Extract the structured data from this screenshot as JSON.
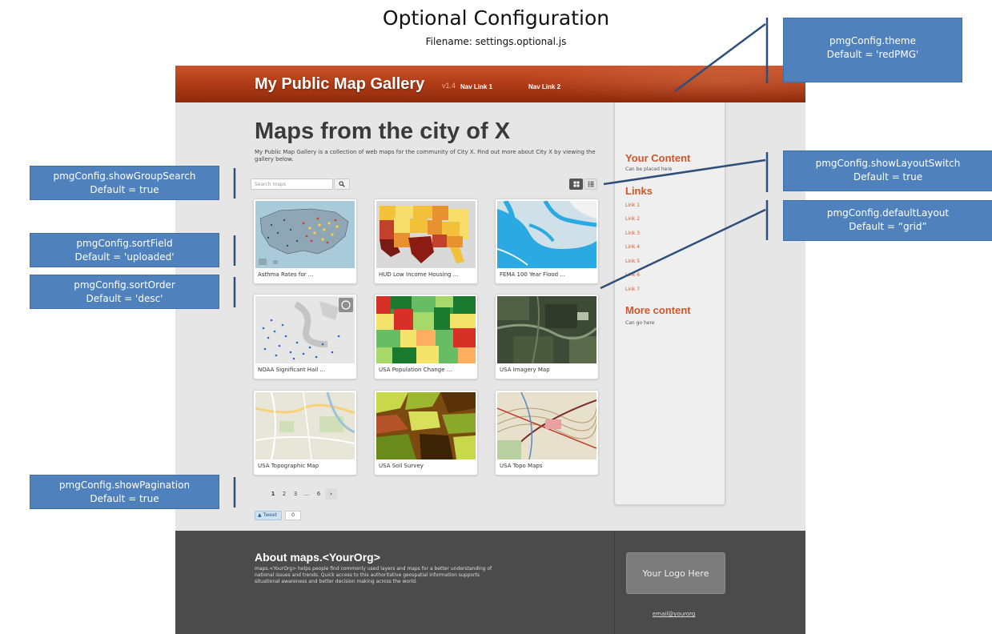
{
  "slide": {
    "title": "Optional Configuration",
    "subtitle": "Filename: settings.optional.js"
  },
  "header": {
    "brand": "My Public Map Gallery",
    "version": "v1.4",
    "nav": [
      "Nav Link 1",
      "Nav Link 2"
    ],
    "theme_color": "#b33d18"
  },
  "main": {
    "title": "Maps from the city of X",
    "intro": "My Public Map Gallery is a collection of web maps for the community of City X. Find out more about City X by viewing the gallery below.",
    "search": {
      "placeholder": "Search maps",
      "button_icon": "search-icon"
    },
    "layout_switch": {
      "grid_icon": "grid-icon",
      "list_icon": "list-icon",
      "active": "grid"
    },
    "cards": [
      {
        "title": "Asthma Rates for ...",
        "thumb": "usa-points-map"
      },
      {
        "title": "HUD Low Income Housing ...",
        "thumb": "usa-choropleth-map"
      },
      {
        "title": "FEMA 100 Year Flood ...",
        "thumb": "coastal-flood-map"
      },
      {
        "title": "NOAA Significant Hail ...",
        "thumb": "hail-points-map"
      },
      {
        "title": "USA Population Change ...",
        "thumb": "population-choropleth-map"
      },
      {
        "title": "USA Imagery Map",
        "thumb": "satellite-imagery"
      },
      {
        "title": "USA Topographic Map",
        "thumb": "topographic-street-map"
      },
      {
        "title": "USA Soil Survey",
        "thumb": "soil-survey-map"
      },
      {
        "title": "USA Topo Maps",
        "thumb": "topo-quad-map"
      }
    ],
    "pagination": {
      "pages": [
        "1",
        "2",
        "3",
        "...",
        "6"
      ],
      "current": "1",
      "next": "›"
    },
    "tweet": {
      "label": "Tweet",
      "count": "0"
    }
  },
  "sidebar": {
    "your_content": {
      "heading": "Your Content",
      "text": "Can be placed here"
    },
    "links": {
      "heading": "Links",
      "items": [
        "Link 1",
        "Link 2",
        "Link 3",
        "Link 4",
        "Link 5",
        "Link 6",
        "Link 7"
      ]
    },
    "more": {
      "heading": "More content",
      "text": "Can go here"
    }
  },
  "footer": {
    "title": "About maps.<YourOrg>",
    "text": "maps.<YourOrg> helps people find commonly used layers and maps for a better understanding of national issues and trends. Quick access to this authoritative geospatial information supports situational awareness and better decision making across the world.",
    "logo": "Your Logo Here",
    "email": "email@yourorg"
  },
  "callouts": {
    "theme": {
      "line1": "pmgConfig.theme",
      "line2": "Default = 'redPMG'"
    },
    "show_layout_switch": {
      "line1": "pmgConfig.showLayoutSwitch",
      "line2": "Default = true"
    },
    "default_layout": {
      "line1": "pmgConfig.defaultLayout",
      "line2": "Default = “grid”"
    },
    "show_group_search": {
      "line1": "pmgConfig.showGroupSearch",
      "line2": "Default = true"
    },
    "sort_field": {
      "line1": "pmgConfig.sortField",
      "line2": "Default = 'uploaded'"
    },
    "sort_order": {
      "line1": "pmgConfig.sortOrder",
      "line2": "Default = 'desc'"
    },
    "show_pagination": {
      "line1": "pmgConfig.showPagination",
      "line2": "Default = true"
    },
    "color": "#4f81bd"
  }
}
